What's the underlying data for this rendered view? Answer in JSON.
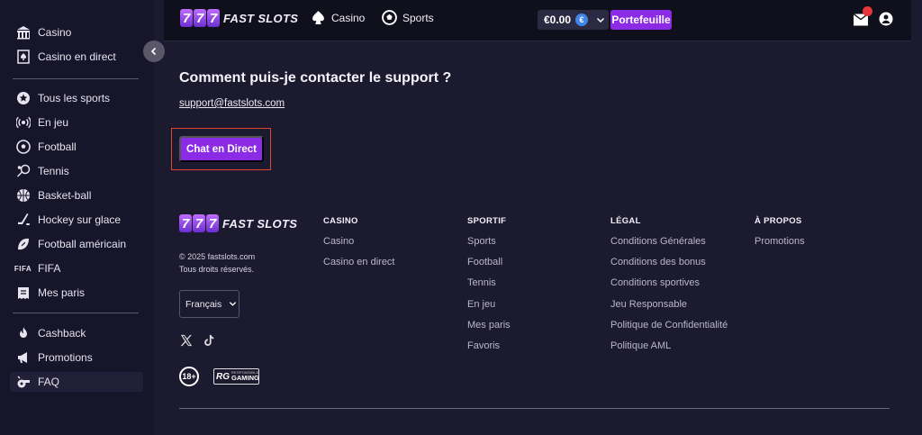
{
  "sidebar": {
    "groups": [
      {
        "items": [
          {
            "label": "Casino",
            "icon": "casino-icon"
          },
          {
            "label": "Casino en direct",
            "icon": "spade-card-icon"
          }
        ]
      },
      {
        "items": [
          {
            "label": "Tous les sports",
            "icon": "star-badge-icon"
          },
          {
            "label": "En jeu",
            "icon": "live-broadcast-icon"
          },
          {
            "label": "Football",
            "icon": "soccer-ball-icon"
          },
          {
            "label": "Tennis",
            "icon": "tennis-racket-icon"
          },
          {
            "label": "Basket-ball",
            "icon": "basketball-icon"
          },
          {
            "label": "Hockey sur glace",
            "icon": "hockey-stick-icon"
          },
          {
            "label": "Football américain",
            "icon": "american-football-icon"
          },
          {
            "label": "FIFA",
            "icon": "fifa-icon"
          },
          {
            "label": "Mes paris",
            "icon": "betslip-icon"
          }
        ]
      },
      {
        "items": [
          {
            "label": "Cashback",
            "icon": "flame-icon"
          },
          {
            "label": "Promotions",
            "icon": "megaphone-icon"
          },
          {
            "label": "FAQ",
            "icon": "whistle-icon",
            "active": true
          }
        ]
      }
    ],
    "fifa_glyph": "FIFA"
  },
  "header": {
    "logo_digits": "777",
    "logo_text": "FAST SLOTS",
    "nav": [
      {
        "label": "Casino",
        "icon": "spade-icon"
      },
      {
        "label": "Sports",
        "icon": "soccer-ball-icon"
      }
    ],
    "balance": "€0.00",
    "currency_symbol": "€",
    "wallet_button": "Portefeuille"
  },
  "main": {
    "faq_question": "Comment puis-je contacter le support ?",
    "support_email": "support@fastslots.com",
    "chat_button": "Chat en Direct"
  },
  "footer": {
    "logo_digits": "777",
    "logo_text": "FAST SLOTS",
    "copyright": "© 2025 fastslots.com",
    "rights": "Tous droits réservés.",
    "language": "Français",
    "badge_18": "18+",
    "rg_mark": "RG",
    "rg_small": "RESPONSIBLE",
    "rg_big": "GAMING",
    "columns": [
      {
        "heading": "CASINO",
        "links": [
          "Casino",
          "Casino en direct"
        ]
      },
      {
        "heading": "SPORTIF",
        "links": [
          "Sports",
          "Football",
          "Tennis",
          "En jeu",
          "Mes paris",
          "Favoris"
        ]
      },
      {
        "heading": "LÉGAL",
        "links": [
          "Conditions Générales",
          "Conditions des bonus",
          "Conditions sportives",
          "Jeu Responsable",
          "Politique de Confidentialité",
          "Politique AML"
        ]
      },
      {
        "heading": "À PROPOS",
        "links": [
          "Promotions"
        ]
      }
    ]
  },
  "colors": {
    "accent": "#8b2be6",
    "background": "#1c1a2e",
    "sidebar": "#16152a",
    "notification": "#e4373b",
    "highlight_outline": "#e0452f"
  }
}
